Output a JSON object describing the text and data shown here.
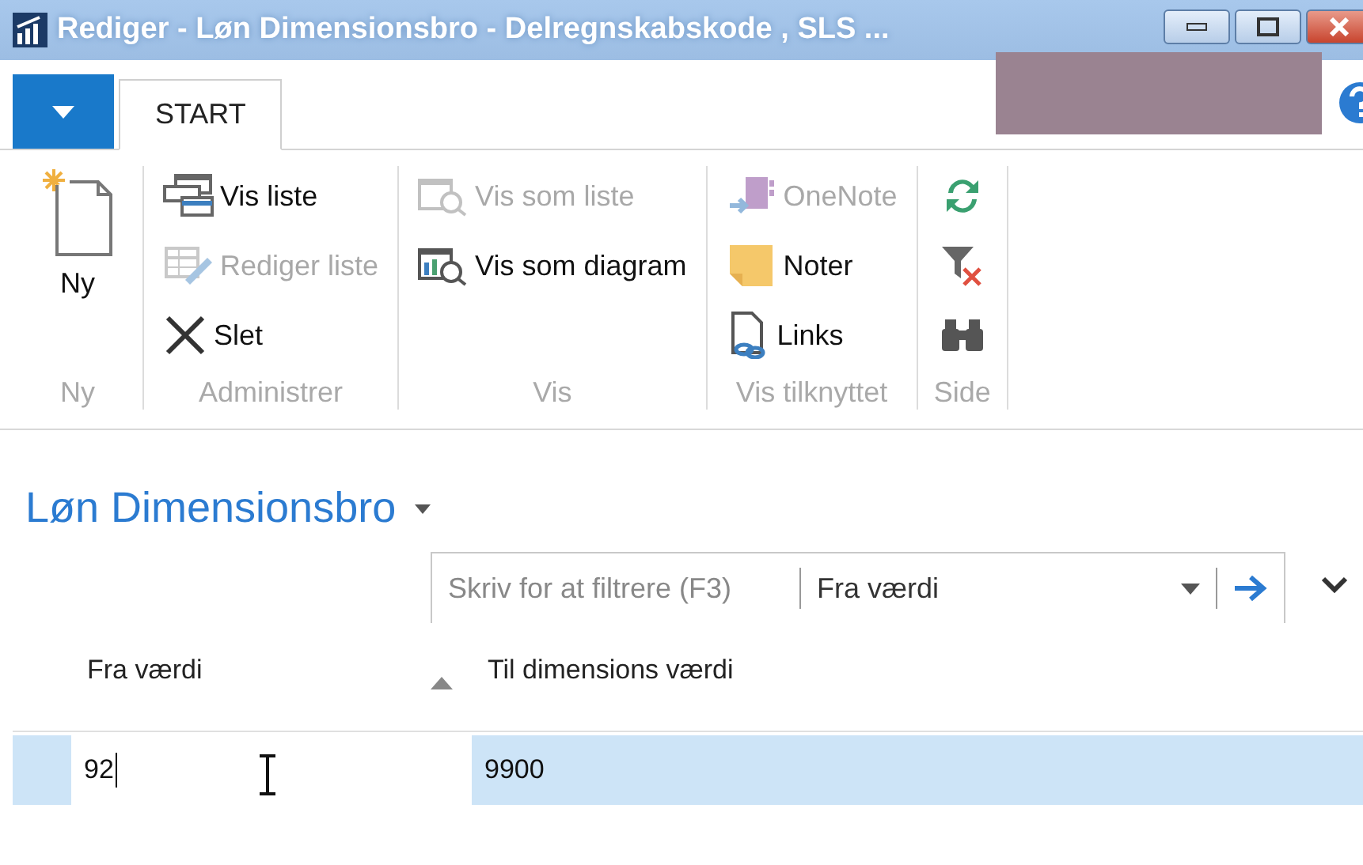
{
  "window": {
    "title": "Rediger - Løn Dimensionsbro - Delregnskabskode , SLS ..."
  },
  "ribbon": {
    "tabs": [
      {
        "label": "START",
        "selected": true
      }
    ],
    "groups": [
      {
        "label": "Ny",
        "items": [
          {
            "label": "Ny",
            "kind": "large",
            "disabled": false
          }
        ]
      },
      {
        "label": "Administrer",
        "items": [
          {
            "label": "Vis liste",
            "kind": "small",
            "disabled": false
          },
          {
            "label": "Rediger liste",
            "kind": "small",
            "disabled": true
          },
          {
            "label": "Slet",
            "kind": "small",
            "disabled": false
          }
        ]
      },
      {
        "label": "Vis",
        "items": [
          {
            "label": "Vis som liste",
            "kind": "small",
            "disabled": true
          },
          {
            "label": "Vis som diagram",
            "kind": "small",
            "disabled": false
          }
        ]
      },
      {
        "label": "Vis tilknyttet",
        "items": [
          {
            "label": "OneNote",
            "kind": "small",
            "disabled": true
          },
          {
            "label": "Noter",
            "kind": "small",
            "disabled": false
          },
          {
            "label": "Links",
            "kind": "small",
            "disabled": false
          }
        ]
      },
      {
        "label": "Side",
        "items": [
          {
            "kind": "icon",
            "disabled": false
          },
          {
            "kind": "icon",
            "disabled": false
          },
          {
            "kind": "icon",
            "disabled": false
          }
        ]
      }
    ]
  },
  "page": {
    "title": "Løn Dimensionsbro",
    "filter": {
      "placeholder": "Skriv for at filtrere (F3)",
      "field": "Fra værdi"
    },
    "table": {
      "columns": [
        {
          "label": "Fra værdi",
          "sorted": true
        },
        {
          "label": "Til dimensions værdi",
          "sorted": false
        }
      ],
      "rows": [
        {
          "selected": true,
          "cells": [
            {
              "value": "92",
              "editing": true
            },
            {
              "value": "9900",
              "editing": false
            }
          ]
        }
      ]
    }
  }
}
